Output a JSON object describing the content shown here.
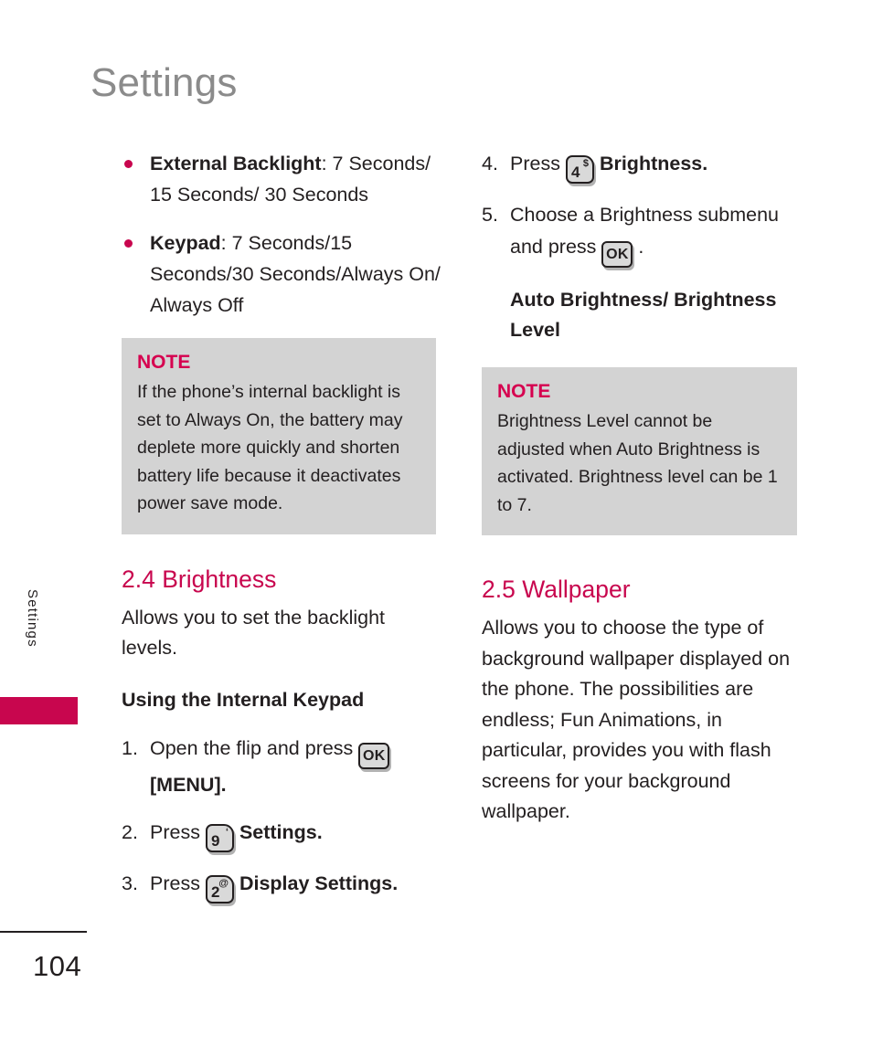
{
  "page": {
    "title": "Settings",
    "number": "104",
    "side_tab_label": "Settings",
    "accent_color": "#c8064e",
    "note_bg_color": "#d3d3d3",
    "title_color": "#8b8b8b"
  },
  "left_column": {
    "bullets": [
      {
        "term": "External Backlight",
        "rest": ": 7 Seconds/\n15 Seconds/ 30 Seconds"
      },
      {
        "term": "Keypad",
        "rest": ": 7 Seconds/15 Seconds/30 Seconds/Always On/ Always Off"
      }
    ],
    "note": {
      "title": "NOTE",
      "body": "If the phone’s internal backlight is set to Always On, the battery may deplete more quickly and shorten battery life because it deactivates power save mode."
    },
    "section": {
      "heading": "2.4 Brightness",
      "intro": "Allows you to set the backlight levels.",
      "subheading": "Using the Internal Keypad"
    },
    "steps": [
      {
        "number": "1.",
        "text_before": "Open the flip and press",
        "key": {
          "type": "ok",
          "label": "OK"
        },
        "text_after": "[MENU].",
        "after_bold": true
      },
      {
        "number": "2.",
        "text_before": "Press",
        "key": {
          "type": "num",
          "digit": "9",
          "sup": "‘"
        },
        "text_after": "Settings.",
        "after_bold": true
      },
      {
        "number": "3.",
        "text_before": "Press",
        "key": {
          "type": "num",
          "digit": "2",
          "sup": "@"
        },
        "text_after": "Display Settings.",
        "after_bold": true
      }
    ]
  },
  "right_column": {
    "steps": [
      {
        "number": "4.",
        "text_before": "Press",
        "key": {
          "type": "num",
          "digit": "4",
          "sup": "$"
        },
        "text_after": "Brightness.",
        "after_bold": true
      },
      {
        "number": "5.",
        "text_before": "Choose a Brightness submenu and press",
        "key": {
          "type": "ok",
          "label": "OK"
        },
        "text_after": ".",
        "after_bold": false
      }
    ],
    "submenu_options": "Auto Brightness/ Brightness Level",
    "note": {
      "title": "NOTE",
      "body": "Brightness Level cannot be adjusted when Auto Brightness is activated. Brightness level can be 1 to 7."
    },
    "section": {
      "heading": "2.5 Wallpaper",
      "body": "Allows you to choose the type of background wallpaper displayed on the phone. The possibilities are endless; Fun Animations, in particular, provides you with flash screens for your background wallpaper."
    }
  }
}
